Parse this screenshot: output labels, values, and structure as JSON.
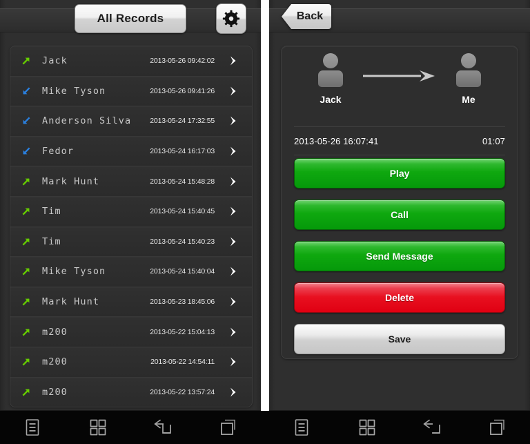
{
  "app": {
    "theme": {
      "background": "#2e2e2e",
      "accent_green": "#0fa80f",
      "accent_red": "#e81020",
      "outgoing_arrow": "#66cc00",
      "incoming_arrow": "#2a7fdd",
      "nav_background": "#050505"
    }
  },
  "left_panel": {
    "header": {
      "title_button": "All Records",
      "settings_icon": "gear-icon"
    },
    "records": [
      {
        "direction": "outgoing",
        "name": "Jack",
        "time": "2013-05-26 09:42:02"
      },
      {
        "direction": "incoming",
        "name": "Mike Tyson",
        "time": "2013-05-26 09:41:26"
      },
      {
        "direction": "incoming",
        "name": "Anderson Silva",
        "time": "2013-05-24 17:32:55"
      },
      {
        "direction": "incoming",
        "name": "Fedor",
        "time": "2013-05-24 16:17:03"
      },
      {
        "direction": "outgoing",
        "name": "Mark Hunt",
        "time": "2013-05-24 15:48:28"
      },
      {
        "direction": "outgoing",
        "name": "Tim",
        "time": "2013-05-24 15:40:45"
      },
      {
        "direction": "outgoing",
        "name": "Tim",
        "time": "2013-05-24 15:40:23"
      },
      {
        "direction": "outgoing",
        "name": "Mike Tyson",
        "time": "2013-05-24 15:40:04"
      },
      {
        "direction": "outgoing",
        "name": "Mark Hunt",
        "time": "2013-05-23 18:45:06"
      },
      {
        "direction": "outgoing",
        "name": "m200",
        "time": "2013-05-22 15:04:13"
      },
      {
        "direction": "outgoing",
        "name": "m200",
        "time": "2013-05-22 14:54:11"
      },
      {
        "direction": "outgoing",
        "name": "m200",
        "time": "2013-05-22 13:57:24"
      }
    ]
  },
  "right_panel": {
    "header": {
      "back_label": "Back"
    },
    "detail": {
      "from_name": "Jack",
      "to_name": "Me",
      "direction_icon": "right-arrow-icon",
      "timestamp": "2013-05-26 16:07:41",
      "duration": "01:07",
      "actions": [
        {
          "label": "Play",
          "style": "green"
        },
        {
          "label": "Call",
          "style": "green"
        },
        {
          "label": "Send Message",
          "style": "green"
        },
        {
          "label": "Delete",
          "style": "red"
        },
        {
          "label": "Save",
          "style": "gray"
        }
      ]
    }
  },
  "navbar": {
    "buttons": [
      {
        "name": "menu-icon",
        "label": "Menu"
      },
      {
        "name": "home-icon",
        "label": "Home"
      },
      {
        "name": "back-icon",
        "label": "Back"
      },
      {
        "name": "recents-icon",
        "label": "Recents"
      }
    ]
  }
}
